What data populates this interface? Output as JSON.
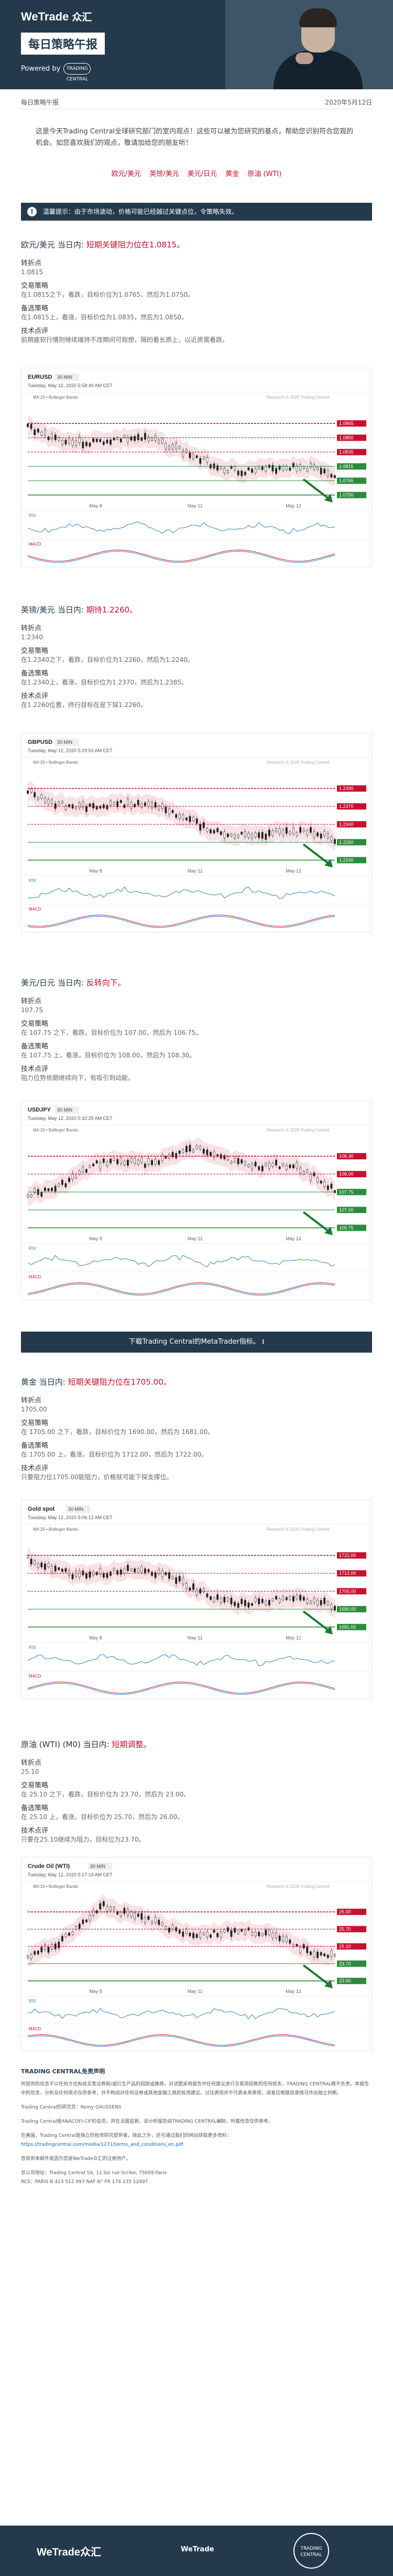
{
  "header": {
    "brand": "WeTrade",
    "brand_cn": "众汇",
    "title": "每日策略午报",
    "powered": "Powered by",
    "tc": "TRADING CENTRAL"
  },
  "datebar": {
    "left": "每日策略午报",
    "right": "2020年5月12日"
  },
  "intro": "这是今天Trading Central全球研究部门的室内观点！这些可以被为您研究的基点，帮助您识别符合您观的机会。如您喜欢我们的观点，敬请加给您的朋友听！",
  "nav": [
    "欧元/美元",
    "英镑/美元",
    "美元/日元",
    "黄金",
    "原油 (WTI)"
  ],
  "notice": "温馨提示：由于市场波动，价格可能已经越过关键点位，令策略失效。",
  "sections": [
    {
      "pair": "欧元/美元",
      "prefix": "当日内:",
      "view": "短期关键阻力位在1.0815。",
      "pivot_l": "转折点",
      "pivot": "1.0815",
      "pref_l": "交易策略",
      "pref": "在1.0815之下，看跌，目标价位为1.0765，然后为1.0750。",
      "alt_l": "备选策略",
      "alt": "在1.0815上，看涨，目标价位为1.0835，然后为1.0850。",
      "tech_l": "技术点评",
      "tech": "前期疲软行情则继续维持不改期间可观想，隔的看长质上，以近质需看跌。"
    },
    {
      "pair": "英镑/美元",
      "prefix": "当日内:",
      "view": "期待1.2260。",
      "pivot_l": "转折点",
      "pivot": "1.2340",
      "pref_l": "交易策略",
      "pref": "在1.2340之下，看跌，目标价位为1.2260，然后为1.2240。",
      "alt_l": "备选策略",
      "alt": "在1.2340上，看涨，目标价位为1.2370，然后为1.2385。",
      "tech_l": "技术点评",
      "tech": "在1.2260位置，终行目标在是下探1.2260。"
    },
    {
      "pair": "美元/日元",
      "prefix": "当日内:",
      "view": "反转向下。",
      "pivot_l": "转折点",
      "pivot": "107.75",
      "pref_l": "交易策略",
      "pref": "在 107.75 之下，看跌，目标价位为 107.00，然后为 106.75。",
      "alt_l": "备选策略",
      "alt": "在 107.75 上，看涨，目标价位为 108.00，然后为 108.30。",
      "tech_l": "技术点评",
      "tech": "阻力位势依期继续向下，有吸引到动能。"
    },
    {
      "pair": "黄金",
      "prefix": "当日内:",
      "view": "短期关键阻力位在1705.00。",
      "pivot_l": "转折点",
      "pivot": "1705.00",
      "pref_l": "交易策略",
      "pref": "在 1705.00 之下，看跌，目标价位为 1690.00，然后为 1681.00。",
      "alt_l": "备选策略",
      "alt": "在 1705.00 上，看涨，目标价位为 1712.00，然后为 1722.00。",
      "tech_l": "技术点评",
      "tech": "只要阻力位1705.00能阻力，价格就可能下探支撑位。"
    },
    {
      "pair": "原油 (WTI) (M0)",
      "prefix": "当日内:",
      "view": "短期调整。",
      "pivot_l": "转折点",
      "pivot": "25.10",
      "pref_l": "交易策略",
      "pref": "在 25.10 之下，看跌，目标价位为 23.70，然后为 23.00。",
      "alt_l": "备选策略",
      "alt": "在 25.10 上，看涨，目标价位为 25.70，然后为 26.00。",
      "tech_l": "技术点评",
      "tech": "只要在25.10继续为阻力，目标位为23.70。"
    }
  ],
  "charts": [
    {
      "symbol": "EURUSD",
      "tf": "30 MIN",
      "date": "Tuesday, May 12, 2020 5:58:40 AM CET",
      "ma": "MA 20 • Bollinger Bands",
      "copyright": "Research © 2020 Trading Central",
      "levels": [
        {
          "v": "1.0865",
          "c": "#c8102e"
        },
        {
          "v": "1.0850",
          "c": "#c8102e"
        },
        {
          "v": "1.0835",
          "c": "#c8102e"
        },
        {
          "v": "1.0815",
          "c": "#2d8b3c"
        },
        {
          "v": "1.0765",
          "c": "#2d8b3c"
        },
        {
          "v": "1.0750",
          "c": "#2d8b3c"
        }
      ],
      "dates": [
        "May 8",
        "May 11",
        "May 12"
      ],
      "osc1": "RSI",
      "osc2": "MACD"
    },
    {
      "symbol": "GBPUSD",
      "tf": "30 MIN",
      "date": "Tuesday, May 12, 2020 5:29:53 AM CET",
      "ma": "MA 20 • Bollinger Bands",
      "copyright": "Research © 2020 Trading Central",
      "levels": [
        {
          "v": "1.2390",
          "c": "#c8102e"
        },
        {
          "v": "1.2370",
          "c": "#c8102e"
        },
        {
          "v": "1.2340",
          "c": "#c8102e"
        },
        {
          "v": "1.2260",
          "c": "#2d8b3c"
        },
        {
          "v": "1.2240",
          "c": "#2d8b3c"
        }
      ],
      "dates": [
        "May 8",
        "May 11",
        "May 12"
      ],
      "osc1": "RSI",
      "osc2": "MACD"
    },
    {
      "symbol": "USDJPY",
      "tf": "30 MIN",
      "date": "Tuesday, May 12, 2020 5:32:25 AM CET",
      "ma": "MA 20 • Bollinger Bands",
      "copyright": "Research © 2020 Trading Central",
      "levels": [
        {
          "v": "108.30",
          "c": "#c8102e"
        },
        {
          "v": "108.00",
          "c": "#c8102e"
        },
        {
          "v": "107.75",
          "c": "#2d8b3c"
        },
        {
          "v": "107.00",
          "c": "#2d8b3c"
        },
        {
          "v": "106.75",
          "c": "#2d8b3c"
        }
      ],
      "dates": [
        "May 8",
        "May 11",
        "May 12"
      ],
      "osc1": "RSI",
      "osc2": "MACD"
    },
    {
      "symbol": "Gold spot",
      "tf": "30 MIN",
      "date": "Tuesday, May 12, 2020 5:06:12 AM CET",
      "ma": "MA 20 • Bollinger Bands",
      "copyright": "Research © 2020 Trading Central",
      "levels": [
        {
          "v": "1722.00",
          "c": "#c8102e"
        },
        {
          "v": "1712.00",
          "c": "#c8102e"
        },
        {
          "v": "1705.00",
          "c": "#c8102e"
        },
        {
          "v": "1690.00",
          "c": "#2d8b3c"
        },
        {
          "v": "1681.00",
          "c": "#2d8b3c"
        }
      ],
      "dates": [
        "May 8",
        "May 11",
        "May 12"
      ],
      "osc1": "RSI",
      "osc2": "MACD"
    },
    {
      "symbol": "Crude Oil (WTI)",
      "tf": "30 MIN",
      "date": "Tuesday, May 12, 2020 5:17:19 AM CET",
      "ma": "MA 20 • Bollinger Bands",
      "copyright": "Research © 2020 Trading Central",
      "levels": [
        {
          "v": "26.00",
          "c": "#c8102e"
        },
        {
          "v": "25.70",
          "c": "#c8102e"
        },
        {
          "v": "25.10",
          "c": "#c8102e"
        },
        {
          "v": "23.70",
          "c": "#2d8b3c"
        },
        {
          "v": "23.00",
          "c": "#2d8b3c"
        }
      ],
      "dates": [
        "May 8",
        "May 11",
        "May 12"
      ],
      "osc1": "RSI",
      "osc2": "MACD"
    }
  ],
  "cta": "下载Trading Central的MetaTrader指标。",
  "disclaimer": {
    "title": "TRADING CENTRAL免责声明",
    "p1": "所提供的信息不以任何方式构成买卖证券和/或衍生产品的招揽或推荐。对试图采用报告中任何建议进行交易而招致的任何损失，TRADING CENTRAL概不负责。本报告中的信息、分析及任何观点仅供参考，并不构成对任何证券或其他金融工具的投资建议。过往表现并不代表未来表现，读者应根据自身情况作出独立判断。",
    "p2": "Trading Central的研究员：Remy GAUSSENS",
    "p3": "Trading Central是ANACOFI-CIF的会员，并在法国监管。该分析报告由TRADING CENTRAL编制，所载信息仅供参考。",
    "p4": "在美国，Trading Central是独立的投资研究提供者。除此之外，还可通过我们的网站获取更多资料：",
    "link": "https://tradingcentral.com/media/1271/terms_and_conditions_en.pdf",
    "p5": "您收到本邮件是因为您是WeTrade众汇的注册用户。",
    "p6": "总公司地址：Trading Central SA, 11 bis rue Scribe, 75009 Paris",
    "p7": "RCS：PARIS B 423 512 997 NAF N° FR 174 235 12997"
  },
  "footer": {
    "left": "WeTrade众汇",
    "mid": "WeTrade",
    "right": "TRADING CENTRAL"
  }
}
